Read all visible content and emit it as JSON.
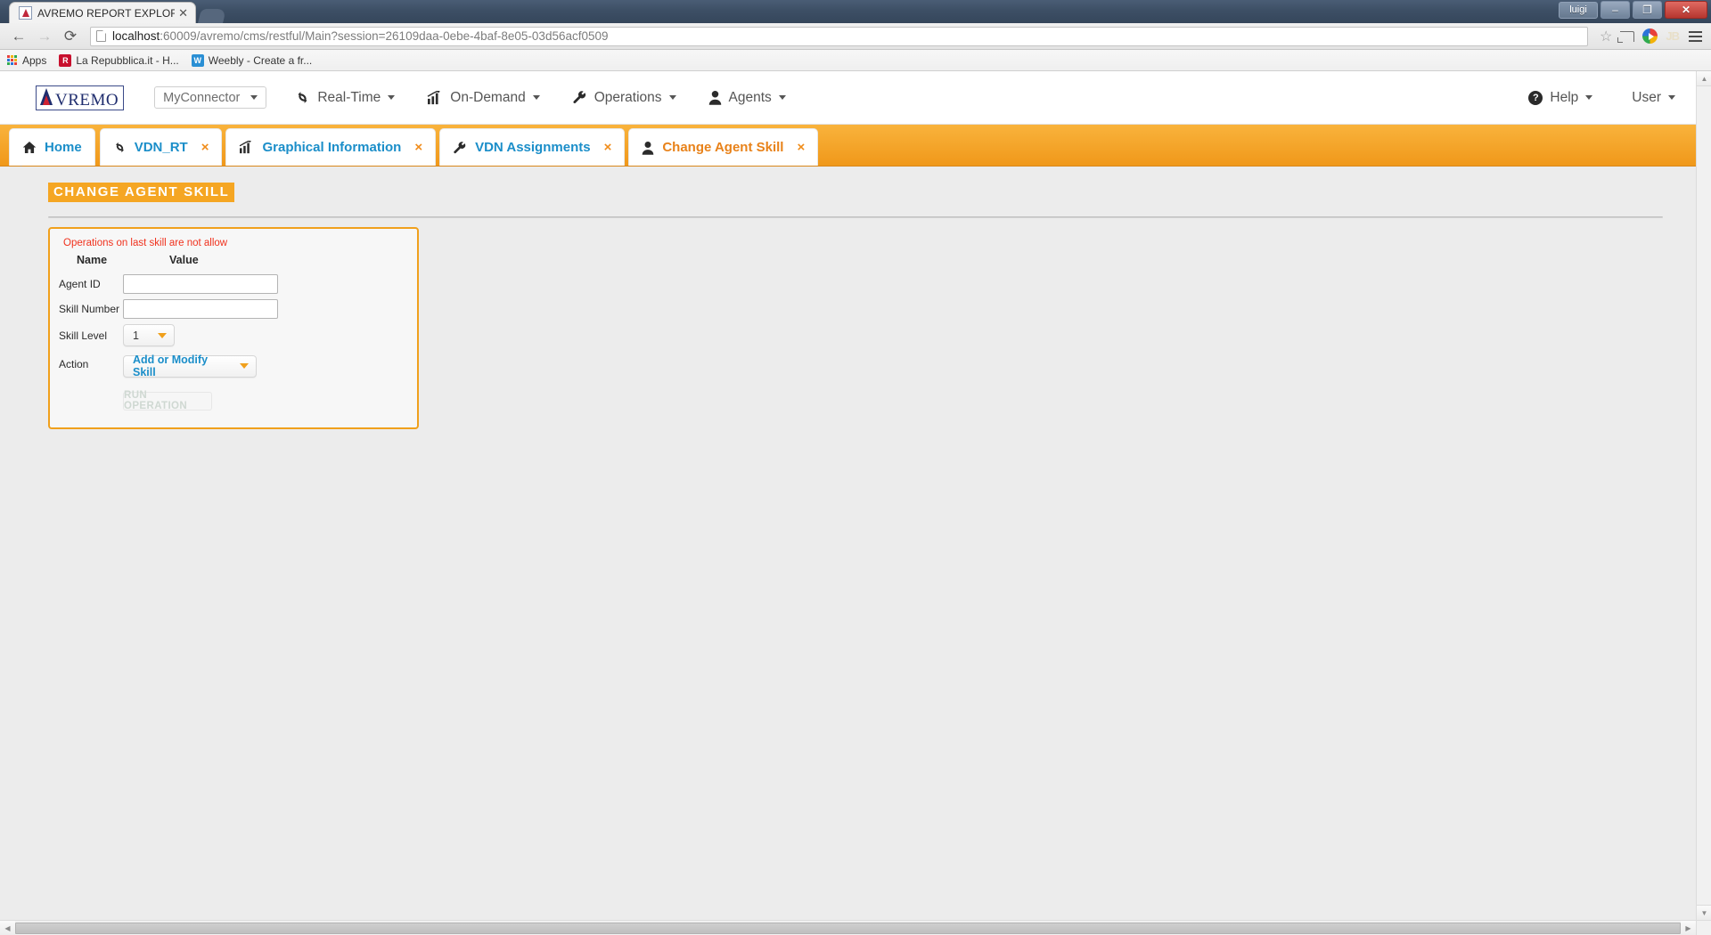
{
  "window": {
    "user_button": "luigi",
    "minimize": "–",
    "maximize": "❐",
    "close": "✕"
  },
  "browser": {
    "tab_title": "AVREMO REPORT EXPLOR",
    "tab_close": "✕",
    "back_icon": "←",
    "forward_icon": "→",
    "reload_icon": "⟳",
    "url_host": "localhost",
    "url_rest": ":60009/avremo/cms/restful/Main?session=26109daa-0ebe-4baf-8e05-03d56acf0509",
    "star_icon": "☆",
    "extension_jb": "JB",
    "bookmarks": [
      {
        "label": "Apps",
        "icon": "apps-grid-icon",
        "color": "#4285f4"
      },
      {
        "label": "La Repubblica.it - H...",
        "icon": "repubblica-favicon",
        "color": "#c8102e",
        "initial": "R"
      },
      {
        "label": "Weebly - Create a fr...",
        "icon": "weebly-favicon",
        "color": "#2a8fd4",
        "initial": "W"
      }
    ]
  },
  "appnav": {
    "logo_letter": "A",
    "logo_word": "VREMO",
    "connector": {
      "label": "MyConnector"
    },
    "items": [
      {
        "label": "Real-Time",
        "icon": "refresh-icon"
      },
      {
        "label": "On-Demand",
        "icon": "bar-chart-icon"
      },
      {
        "label": "Operations",
        "icon": "wrench-icon"
      },
      {
        "label": "Agents",
        "icon": "user-icon"
      }
    ],
    "right_items": [
      {
        "label": "Help",
        "icon": "question-circle-icon"
      },
      {
        "label": "User",
        "icon": "none"
      }
    ]
  },
  "apptabs": [
    {
      "label": "Home",
      "icon": "home-icon",
      "closable": false,
      "active": false
    },
    {
      "label": "VDN_RT",
      "icon": "refresh-icon",
      "closable": true,
      "active": false
    },
    {
      "label": "Graphical Information",
      "icon": "bar-chart-icon",
      "closable": true,
      "active": false
    },
    {
      "label": "VDN Assignments",
      "icon": "wrench-icon",
      "closable": true,
      "active": false
    },
    {
      "label": "Change Agent Skill",
      "icon": "user-icon",
      "closable": true,
      "active": true
    }
  ],
  "tab_close_glyph": "×",
  "main": {
    "section_title": "CHANGE AGENT SKILL",
    "error_message": "Operations on last skill are not allow",
    "columns": {
      "name": "Name",
      "value": "Value"
    },
    "fields": [
      {
        "label": "Agent ID",
        "type": "text",
        "value": "",
        "placeholder": ""
      },
      {
        "label": "Skill Number",
        "type": "text",
        "value": "",
        "placeholder": ""
      },
      {
        "label": "Skill Level",
        "type": "select",
        "value": "1"
      },
      {
        "label": "Action",
        "type": "select",
        "value": "Add or Modify Skill"
      }
    ],
    "run_button": "RUN OPERATION"
  },
  "colors": {
    "accent_orange": "#f5a623",
    "link_blue": "#1b8ec9",
    "error_red": "#f0321e",
    "active_tab": "#e8821a"
  }
}
